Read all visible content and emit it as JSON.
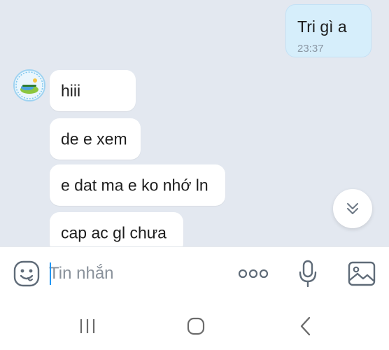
{
  "chat": {
    "outgoing": [
      {
        "text": "Tri gì a",
        "time": "23:37"
      }
    ],
    "incoming": [
      {
        "text": "hiii"
      },
      {
        "text": "de e xem"
      },
      {
        "text": "e dat ma e ko nhớ ln"
      },
      {
        "text": "cap ac gl chưa"
      }
    ]
  },
  "composer": {
    "placeholder": "Tin nhắn",
    "value": ""
  },
  "icons": {
    "sticker": "smiley-sticker-icon",
    "more": "more-options-icon",
    "mic": "microphone-icon",
    "image": "image-gallery-icon",
    "scroll": "chevron-double-down-icon",
    "nav_recent": "recent-apps-icon",
    "nav_home": "home-icon",
    "nav_back": "back-icon"
  },
  "colors": {
    "chat_background": "#e3e8f0",
    "outgoing_bubble": "#d6eefb",
    "incoming_bubble": "#ffffff",
    "caret": "#2196f3",
    "icon_gray": "#5f6b78"
  }
}
